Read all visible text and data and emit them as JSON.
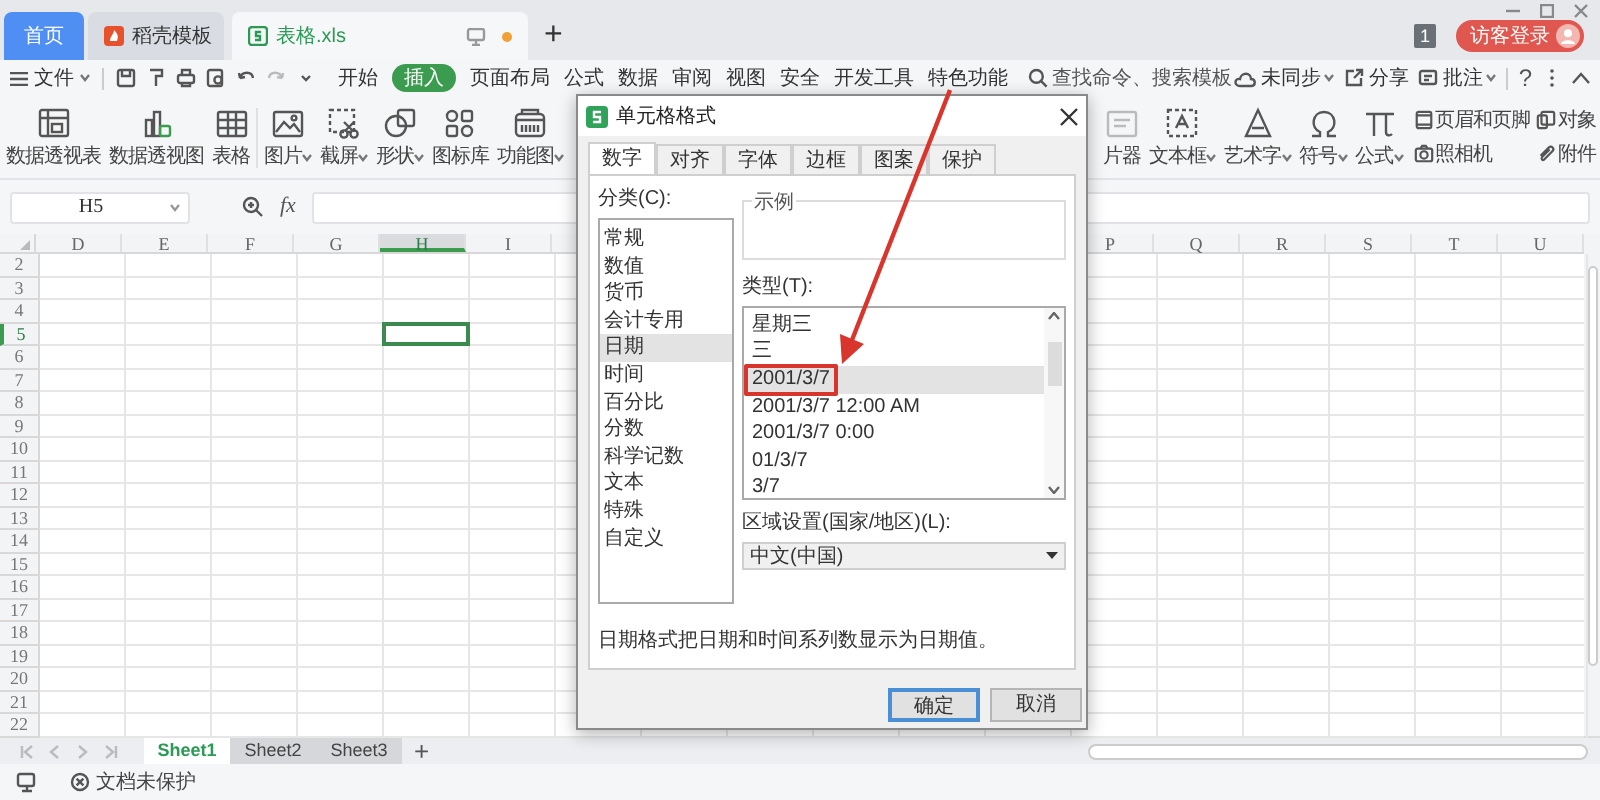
{
  "title_tabs": [
    {
      "label": "首页",
      "kind": "home",
      "selected": false
    },
    {
      "label": "稻壳模板",
      "kind": "docer",
      "selected": false
    },
    {
      "label": "表格.xls",
      "kind": "file",
      "selected": true
    }
  ],
  "new_tab": "+",
  "notification_count": "1",
  "login_button": "访客登录",
  "menu": {
    "file": "文件",
    "tabs": [
      {
        "label": "开始",
        "selected": false
      },
      {
        "label": "插入",
        "selected": true
      },
      {
        "label": "页面布局",
        "selected": false
      },
      {
        "label": "公式",
        "selected": false
      },
      {
        "label": "数据",
        "selected": false
      },
      {
        "label": "审阅",
        "selected": false
      },
      {
        "label": "视图",
        "selected": false
      },
      {
        "label": "安全",
        "selected": false
      },
      {
        "label": "开发工具",
        "selected": false
      },
      {
        "label": "特色功能",
        "selected": false
      }
    ],
    "search_placeholder": "查找命令、搜索模板",
    "sync": "未同步",
    "share": "分享",
    "comment": "批注",
    "help": "?"
  },
  "ribbon_left": [
    {
      "label": "数据透视表",
      "dropdown": false
    },
    {
      "label": "数据透视图",
      "dropdown": false
    },
    {
      "label": "表格",
      "dropdown": false
    },
    {
      "label": "图片",
      "dropdown": true
    },
    {
      "label": "截屏",
      "dropdown": true
    },
    {
      "label": "形状",
      "dropdown": true
    },
    {
      "label": "图标库",
      "dropdown": false
    },
    {
      "label": "功能图",
      "dropdown": true
    }
  ],
  "ribbon_right": [
    {
      "label": "片器",
      "dropdown": false
    },
    {
      "label": "文本框",
      "dropdown": true
    },
    {
      "label": "艺术字",
      "dropdown": true
    },
    {
      "label": "符号",
      "dropdown": true
    },
    {
      "label": "公式",
      "dropdown": true
    }
  ],
  "ribbon_small": [
    {
      "label": "页眉和页脚"
    },
    {
      "label": "照相机"
    },
    {
      "label": "对象"
    },
    {
      "label": "附件"
    }
  ],
  "name_box": "H5",
  "formula_label": "fx",
  "columns": [
    {
      "label": "D",
      "selected": false
    },
    {
      "label": "E",
      "selected": false
    },
    {
      "label": "F",
      "selected": false
    },
    {
      "label": "G",
      "selected": false
    },
    {
      "label": "H",
      "selected": true
    },
    {
      "label": "I",
      "selected": false
    },
    {
      "label": "P",
      "selected": false
    },
    {
      "label": "Q",
      "selected": false
    },
    {
      "label": "R",
      "selected": false
    },
    {
      "label": "S",
      "selected": false
    },
    {
      "label": "T",
      "selected": false
    },
    {
      "label": "U",
      "selected": false
    }
  ],
  "rows": [
    {
      "label": "2",
      "selected": false
    },
    {
      "label": "3",
      "selected": false
    },
    {
      "label": "4",
      "selected": false
    },
    {
      "label": "5",
      "selected": true
    },
    {
      "label": "6",
      "selected": false
    },
    {
      "label": "7",
      "selected": false
    },
    {
      "label": "8",
      "selected": false
    },
    {
      "label": "9",
      "selected": false
    },
    {
      "label": "10",
      "selected": false
    },
    {
      "label": "11",
      "selected": false
    },
    {
      "label": "12",
      "selected": false
    },
    {
      "label": "13",
      "selected": false
    },
    {
      "label": "14",
      "selected": false
    },
    {
      "label": "15",
      "selected": false
    },
    {
      "label": "16",
      "selected": false
    },
    {
      "label": "17",
      "selected": false
    },
    {
      "label": "18",
      "selected": false
    },
    {
      "label": "19",
      "selected": false
    },
    {
      "label": "20",
      "selected": false
    },
    {
      "label": "21",
      "selected": false
    },
    {
      "label": "22",
      "selected": false
    }
  ],
  "sheets": [
    {
      "label": "Sheet1",
      "selected": true
    },
    {
      "label": "Sheet2",
      "selected": false
    },
    {
      "label": "Sheet3",
      "selected": false
    }
  ],
  "add_sheet": "+",
  "status": "文档未保护",
  "dialog": {
    "title": "单元格格式",
    "tabs": [
      {
        "label": "数字",
        "selected": true
      },
      {
        "label": "对齐",
        "selected": false
      },
      {
        "label": "字体",
        "selected": false
      },
      {
        "label": "边框",
        "selected": false
      },
      {
        "label": "图案",
        "selected": false
      },
      {
        "label": "保护",
        "selected": false
      }
    ],
    "category_label": "分类(C):",
    "categories": [
      {
        "label": "常规",
        "selected": false
      },
      {
        "label": "数值",
        "selected": false
      },
      {
        "label": "货币",
        "selected": false
      },
      {
        "label": "会计专用",
        "selected": false
      },
      {
        "label": "日期",
        "selected": true
      },
      {
        "label": "时间",
        "selected": false
      },
      {
        "label": "百分比",
        "selected": false
      },
      {
        "label": "分数",
        "selected": false
      },
      {
        "label": "科学记数",
        "selected": false
      },
      {
        "label": "文本",
        "selected": false
      },
      {
        "label": "特殊",
        "selected": false
      },
      {
        "label": "自定义",
        "selected": false
      }
    ],
    "sample_label": "示例",
    "type_label": "类型(T):",
    "types": [
      {
        "label": "星期三",
        "selected": false,
        "highlighted": false
      },
      {
        "label": "三",
        "selected": false,
        "highlighted": false
      },
      {
        "label": "2001/3/7",
        "selected": true,
        "highlighted": true
      },
      {
        "label": "2001/3/7 12:00 AM",
        "selected": false,
        "highlighted": false
      },
      {
        "label": "2001/3/7 0:00",
        "selected": false,
        "highlighted": false
      },
      {
        "label": "01/3/7",
        "selected": false,
        "highlighted": false
      },
      {
        "label": "3/7",
        "selected": false,
        "highlighted": false
      }
    ],
    "locale_label": "区域设置(国家/地区)(L):",
    "locale": "中文(中国)",
    "description": "日期格式把日期和时间系列数显示为日期值。",
    "buttons": [
      {
        "label": "确定",
        "kind": "primary"
      },
      {
        "label": "取消",
        "kind": "secondary"
      }
    ]
  }
}
